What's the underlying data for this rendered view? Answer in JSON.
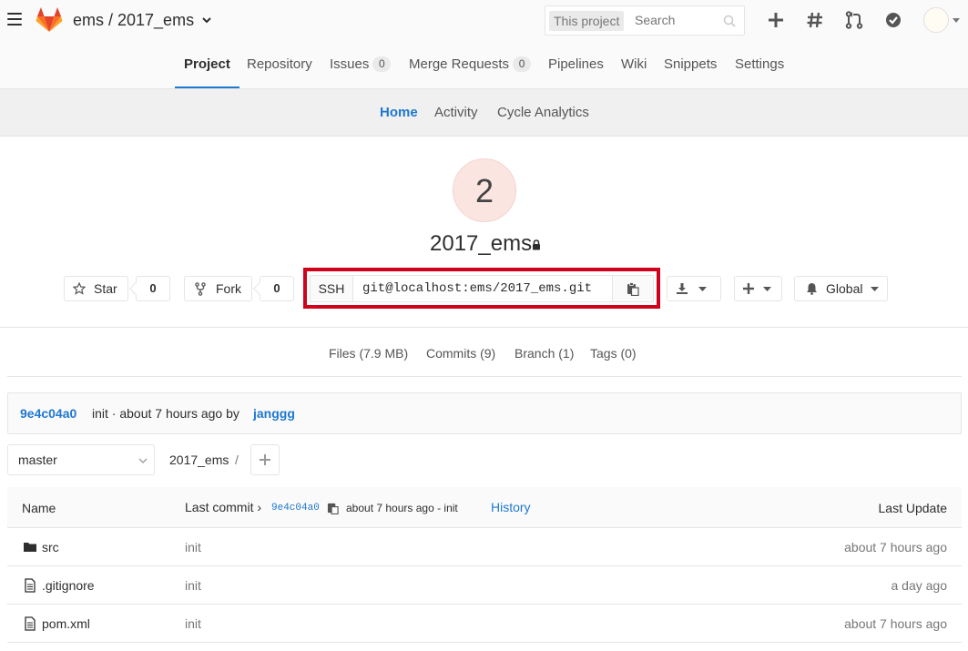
{
  "header": {
    "project_path": "ems / 2017_ems",
    "search_scope": "This project",
    "search_placeholder": "Search"
  },
  "nav_tabs": [
    {
      "label": "Project"
    },
    {
      "label": "Repository"
    },
    {
      "label": "Issues",
      "count": "0"
    },
    {
      "label": "Merge Requests",
      "count": "0"
    },
    {
      "label": "Pipelines"
    },
    {
      "label": "Wiki"
    },
    {
      "label": "Snippets"
    },
    {
      "label": "Settings"
    }
  ],
  "sub_tabs": [
    {
      "label": "Home"
    },
    {
      "label": "Activity"
    },
    {
      "label": "Cycle Analytics"
    }
  ],
  "project": {
    "avatar_letter": "2",
    "name": "2017_ems"
  },
  "actions": {
    "star_label": "Star",
    "star_count": "0",
    "fork_label": "Fork",
    "fork_count": "0",
    "protocol": "SSH",
    "clone_url": "git@localhost:ems/2017_ems.git",
    "notification_label": "Global"
  },
  "stats": {
    "files": "Files (7.9 MB)",
    "commits": "Commits (9)",
    "branch": "Branch (1)",
    "tags": "Tags (0)"
  },
  "last_commit": {
    "sha": "9e4c04a0",
    "message": "init · about 7 hours ago by",
    "author": "janggg"
  },
  "tree": {
    "branch": "master",
    "path": "2017_ems",
    "separator": "/"
  },
  "table": {
    "col_name": "Name",
    "col_last_commit": "Last commit",
    "commit_sha": "9e4c04a0",
    "commit_time": "about 7 hours ago - init",
    "history": "History",
    "col_last_update": "Last Update",
    "rows": [
      {
        "name": "src",
        "message": "init",
        "updated": "about 7 hours ago",
        "icon": "folder-icon"
      },
      {
        "name": ".gitignore",
        "message": "init",
        "updated": "a day ago",
        "icon": "file-icon"
      },
      {
        "name": "pom.xml",
        "message": "init",
        "updated": "about 7 hours ago",
        "icon": "file-icon"
      }
    ]
  },
  "colors": {
    "accent": "#1f78d1",
    "highlight": "#d0021b",
    "logo": "#e24329"
  }
}
